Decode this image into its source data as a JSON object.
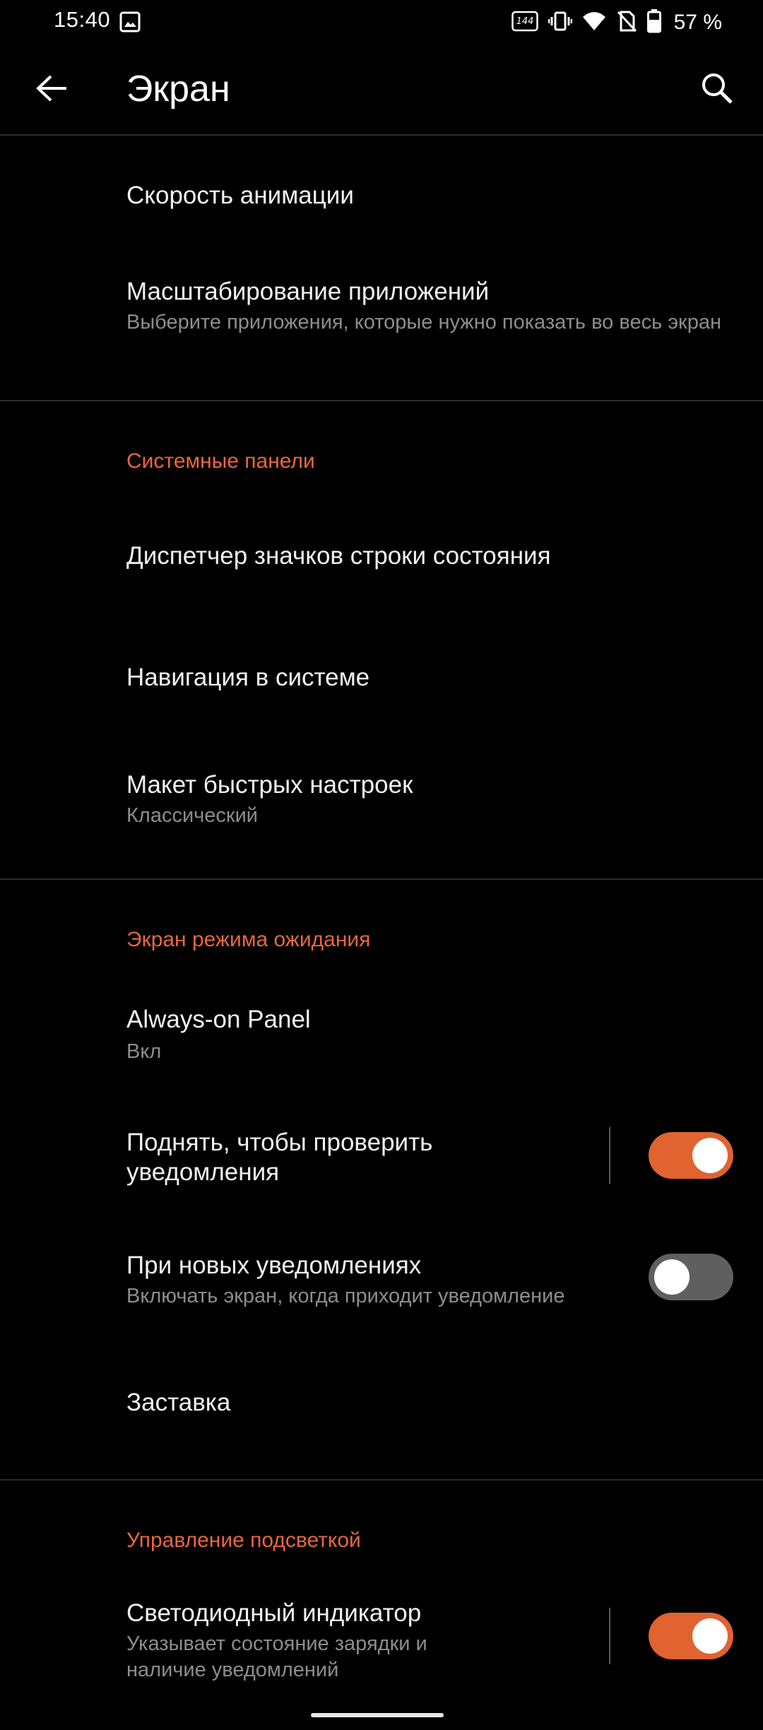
{
  "status_bar": {
    "time": "15:40",
    "refresh_badge": "144",
    "battery_text": "57 %",
    "icons": [
      "image-icon",
      "refresh-rate-icon",
      "vibrate-icon",
      "wifi-icon",
      "no-sim-icon",
      "battery-icon"
    ]
  },
  "app_bar": {
    "title": "Экран",
    "back_icon": "arrow-back-icon",
    "search_icon": "search-icon"
  },
  "items": {
    "animation_speed": {
      "title": "Скорость анимации"
    },
    "app_scaling": {
      "title": "Масштабирование приложений",
      "subtitle": "Выберите приложения, которые нужно показать во весь экран"
    },
    "status_icons": {
      "title": "Диспетчер значков строки состояния"
    },
    "navigation": {
      "title": "Навигация в системе"
    },
    "quick_settings_layout": {
      "title": "Макет быстрых настроек",
      "subtitle": "Классический"
    },
    "always_on_panel": {
      "title": "Always-on Panel",
      "subtitle": "Вкл"
    },
    "lift_to_check": {
      "title": "Поднять, чтобы проверить уведомления",
      "toggle_on": true
    },
    "new_notifications": {
      "title": "При новых уведомлениях",
      "subtitle": "Включать экран, когда приходит уведомление",
      "toggle_on": false
    },
    "screensaver": {
      "title": "Заставка"
    },
    "led_indicator": {
      "title": "Светодиодный индикатор",
      "subtitle": "Указывает состояние зарядки и наличие уведомлений",
      "toggle_on": true
    }
  },
  "sections": {
    "system_panels": "Системные панели",
    "standby_screen": "Экран режима ожидания",
    "backlight_control": "Управление подсветкой"
  },
  "colors": {
    "accent": "#e06330",
    "section_header": "#e8673c",
    "background": "#000000",
    "toggle_off": "#5f5f5f"
  }
}
